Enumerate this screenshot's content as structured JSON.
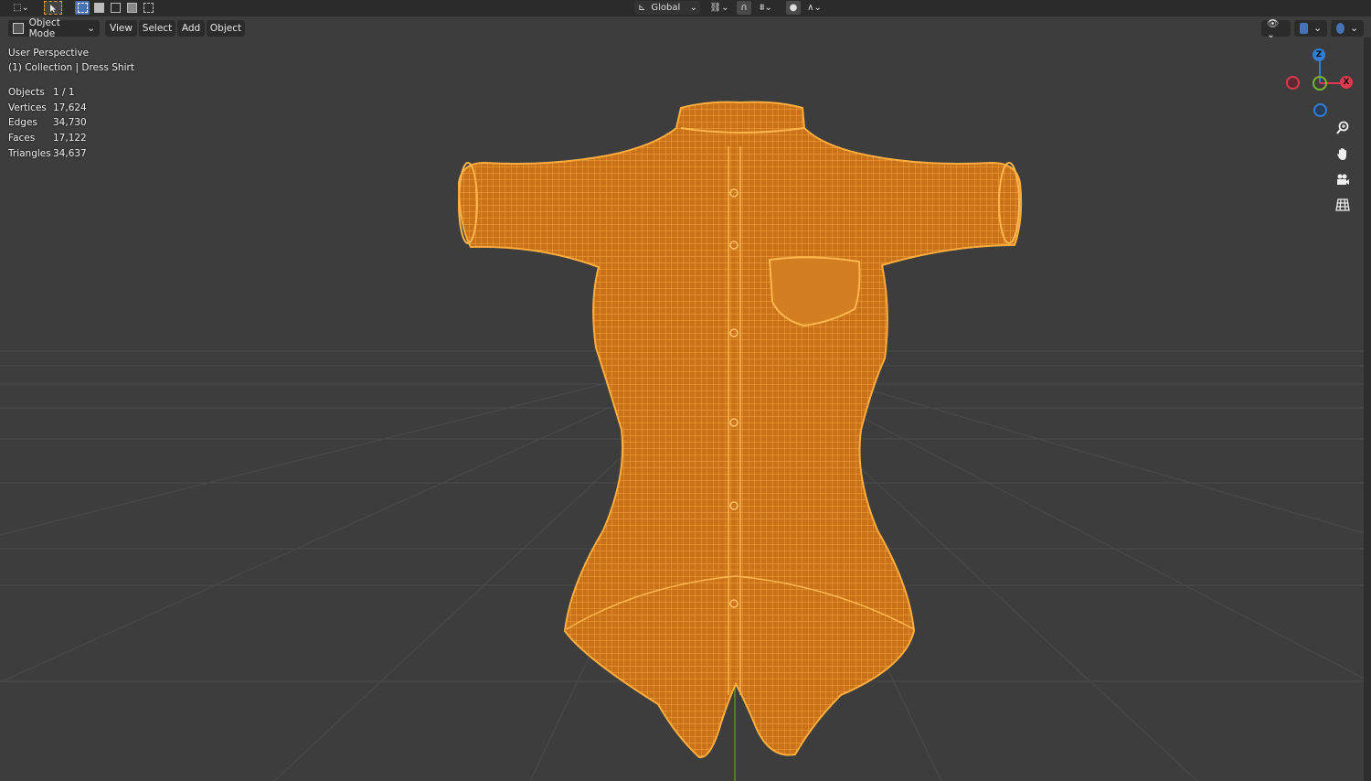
{
  "toolbar": {
    "transform_orientation": "Global"
  },
  "header": {
    "mode_label": "Object Mode",
    "menus": [
      "View",
      "Select",
      "Add",
      "Object"
    ]
  },
  "overlay": {
    "view_name": "User Perspective",
    "collection_line": "(1) Collection | Dress Shirt",
    "stats": [
      {
        "label": "Objects",
        "value": "1 / 1"
      },
      {
        "label": "Vertices",
        "value": "17,624"
      },
      {
        "label": "Edges",
        "value": "34,730"
      },
      {
        "label": "Faces",
        "value": "17,122"
      },
      {
        "label": "Triangles",
        "value": "34,637"
      }
    ]
  },
  "gizmo": {
    "x_label": "X",
    "z_label": "Z"
  },
  "colors": {
    "viewport_bg": "#3d3d3d",
    "wire": "#f39c28",
    "axis_x": "#e0384e",
    "axis_y": "#7bb82a",
    "axis_z": "#2f7fd6",
    "y_line": "#5d8f2a"
  },
  "icons": [
    "editor-type-icon",
    "select-cursor-icon",
    "select-mode-icons",
    "transform-orientation-icon",
    "pivot-icon",
    "snap-icon",
    "proportional-edit-icon",
    "visibility-icon",
    "gizmo-toggle-icon",
    "overlay-icon",
    "zoom-icon",
    "hand-pan-icon",
    "camera-icon",
    "grid-view-icon"
  ]
}
